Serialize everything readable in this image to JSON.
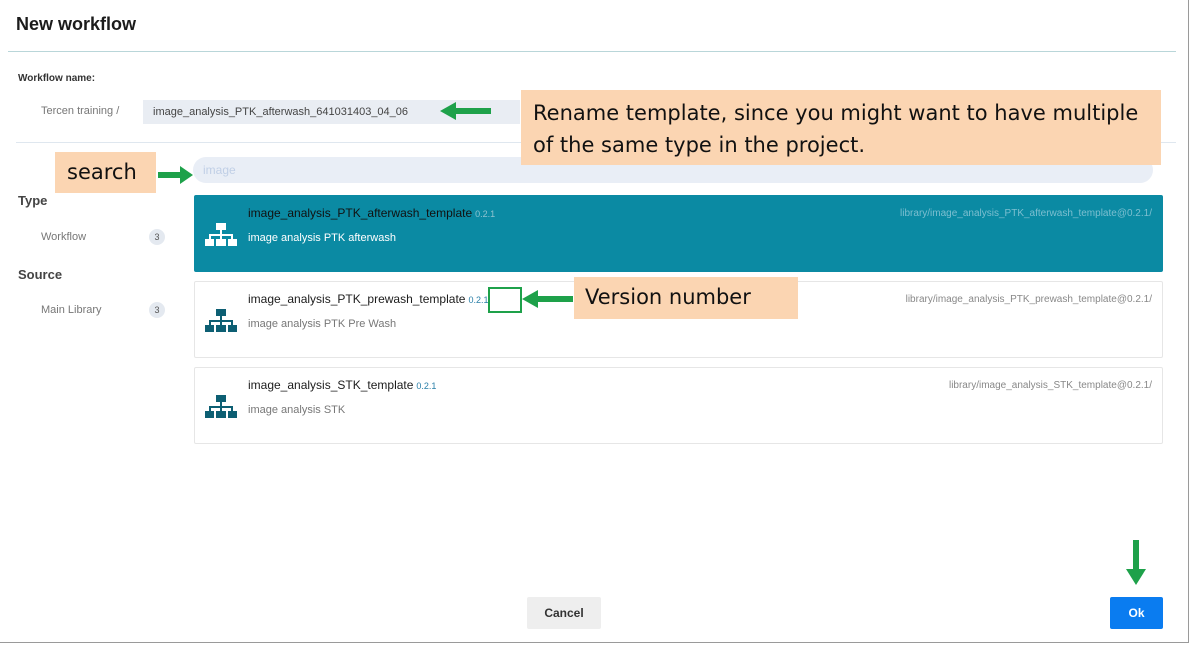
{
  "dialog": {
    "title": "New workflow"
  },
  "workflow_name": {
    "label": "Workflow name:",
    "project": "Tercen training  /",
    "value": "image_analysis_PTK_afterwash_641031403_04_06"
  },
  "search": {
    "value": "image"
  },
  "sidebar": {
    "type_heading": "Type",
    "type_items": [
      {
        "label": "Workflow",
        "count": "3"
      }
    ],
    "source_heading": "Source",
    "source_items": [
      {
        "label": "Main Library",
        "count": "3"
      }
    ]
  },
  "templates": [
    {
      "name": "image_analysis_PTK_afterwash_template",
      "version": "0.2.1",
      "description": "image analysis PTK afterwash",
      "path": "library/image_analysis_PTK_afterwash_template@0.2.1/",
      "selected": true
    },
    {
      "name": "image_analysis_PTK_prewash_template",
      "version": "0.2.1",
      "description": "image analysis PTK Pre Wash",
      "path": "library/image_analysis_PTK_prewash_template@0.2.1/",
      "selected": false
    },
    {
      "name": "image_analysis_STK_template",
      "version": "0.2.1",
      "description": "image analysis STK",
      "path": "library/image_analysis_STK_template@0.2.1/",
      "selected": false
    }
  ],
  "annotations": {
    "rename": "Rename template, since you might want to have multiple of the same type in the project.",
    "search": "search",
    "version": "Version number"
  },
  "buttons": {
    "cancel": "Cancel",
    "ok": "Ok"
  },
  "colors": {
    "accent": "#0b8aa3",
    "primary_button": "#0a7cf0",
    "annotation_arrow": "#1ea14a",
    "annotation_box": "#fbd5b2"
  },
  "icons": {
    "template": "hierarchy-icon"
  }
}
